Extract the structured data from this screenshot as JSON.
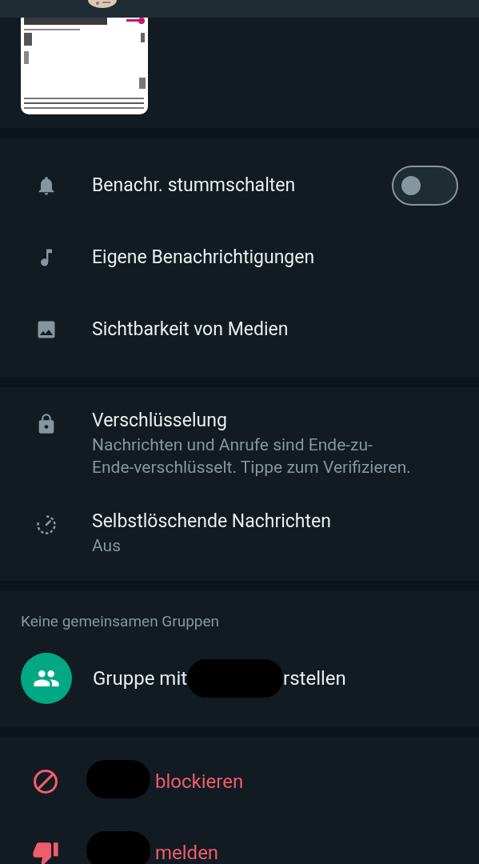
{
  "notification_settings": [
    {
      "label": "Benachr. stummschalten",
      "kind": "toggle",
      "on": false
    },
    {
      "label": "Eigene Benachrichtigungen",
      "kind": "plain"
    },
    {
      "label": "Sichtbarkeit von Medien",
      "kind": "plain"
    }
  ],
  "privacy_settings": [
    {
      "label": "Verschlüsselung",
      "subtitle": "Nachrichten und Anrufe sind Ende-zu-Ende-verschlüsselt. Tippe zum Verifizieren."
    },
    {
      "label": "Selbstlöschende Nachrichten",
      "subtitle": "Aus"
    }
  ],
  "groups": {
    "header": "Keine gemeinsamen Gruppen",
    "create_group": {
      "before": "Gruppe mit",
      "after": "rstellen"
    }
  },
  "actions": [
    {
      "label": "blockieren"
    },
    {
      "label": "melden"
    }
  ]
}
